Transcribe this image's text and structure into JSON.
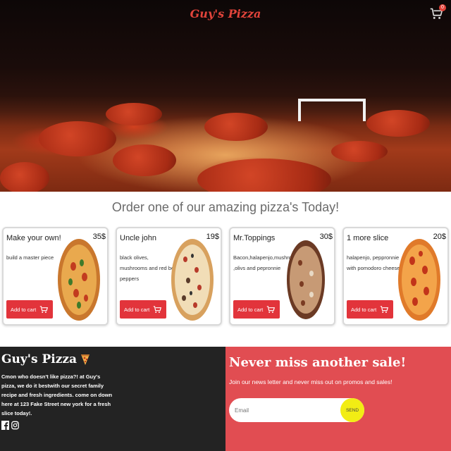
{
  "header": {
    "brand": "Guy's Pizza",
    "cart_count": "0"
  },
  "menu": {
    "heading": "Order one of our amazing pizza's Today!",
    "items": [
      {
        "name": "Make your own!",
        "price": "35$",
        "description": "build a master piece",
        "button": "Add to cart",
        "style": "margherita"
      },
      {
        "name": "Uncle john",
        "price": "19$",
        "description": "black olives, mushrooms and red bell peppers",
        "button": "Add to cart",
        "style": "veggie"
      },
      {
        "name": "Mr.Toppings",
        "price": "30$",
        "description": "Bacon,halapenjo,mushrooms ,olivs and pepronnie",
        "button": "Add to cart",
        "style": "supreme"
      },
      {
        "name": "1 more slice",
        "price": "20$",
        "description": "halapenjo, peppronnie with pomodoro cheese",
        "button": "Add to cart",
        "style": "pepperoni"
      }
    ]
  },
  "footer": {
    "brand": "Guy's Pizza",
    "about": "Cmon who doesn't like pizza?! at Guy's pizza, we do it bestwith our secret family recipe and fresh ingredients. come on down here at 123 Fake Street new york for a fresh slice today!.",
    "socials": [
      "facebook-icon",
      "instagram-icon"
    ],
    "newsletter_title": "Never miss another sale!",
    "newsletter_sub": "Join our news letter and never miss out on promos and sales!",
    "email_placeholder": "Email",
    "send_label": "SEND"
  },
  "colors": {
    "accent": "#e2343b",
    "footer_dark": "#232323",
    "footer_red": "#e14d52",
    "send_yellow": "#f2ed14"
  }
}
